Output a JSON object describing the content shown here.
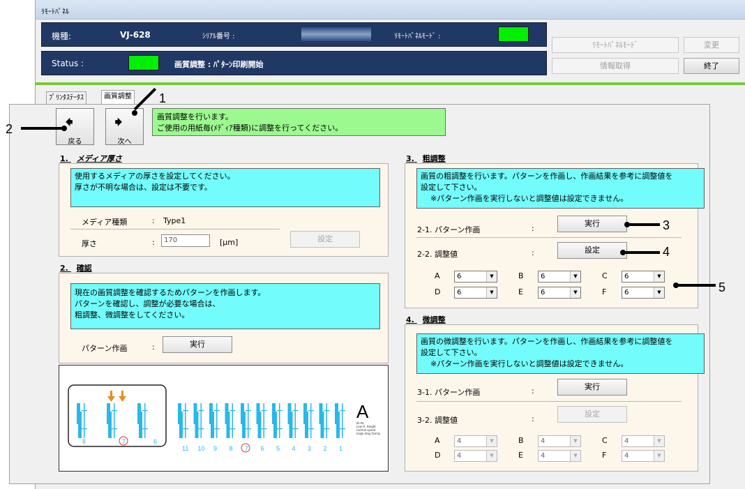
{
  "window": {
    "title": "ﾘﾓｰﾄﾊﾟﾈﾙ"
  },
  "header": {
    "model_label": "機種:",
    "model_value": "VJ-628",
    "serial_label": "ｼﾘｱﾙ番号 :",
    "remote_mode_label": "ﾘﾓｰﾄﾊﾟﾈﾙﾓｰﾄﾞ :",
    "status_label": "Status :",
    "status_text": "画質調整 : ﾊﾟﾀｰﾝ印刷開始",
    "lamp_color": "#00f000",
    "buttons": {
      "remote_mode": "ﾘﾓｰﾄﾊﾟﾈﾙﾓｰﾄﾞ",
      "change": "変更",
      "get_info": "情報取得",
      "exit": "終了"
    }
  },
  "tabs": [
    {
      "label": "ﾌﾟﾘﾝﾀｽﾃｰﾀｽ",
      "active": false
    },
    {
      "label": "画質調整",
      "active": true
    }
  ],
  "nav": {
    "back_label": "戻る",
    "next_label": "次へ",
    "back_icon": "arrow-left-icon",
    "next_icon": "arrow-right-icon",
    "message_line1": "画質調整を行います。",
    "message_line2": "ご使用の用紙毎(ﾒﾃﾞｨｱ種類)に調整を行ってください。"
  },
  "section1": {
    "number": "1.",
    "title": "メディア厚さ",
    "info_line1": "使用するメディアの厚さを設定してください。",
    "info_line2": "厚さが不明な場合は、設定は不要です。",
    "media_type_label": "メディア種類",
    "colon": ":",
    "media_type_value": "Type1",
    "thickness_label": "厚さ",
    "thickness_value": "170",
    "unit": "[μm]",
    "set_button": "設定"
  },
  "section2": {
    "number": "2.",
    "title": "確認",
    "info_line1": "現在の画質調整を確認するためパターンを作画します。",
    "info_line2": "パターンを確認し、調整が必要な場合は、",
    "info_line3": "粗調整、微調整をしてください。",
    "pattern_label": "パターン作画",
    "colon": ":",
    "run_button": "実行"
  },
  "pattern_image": {
    "left_nums": [
      "8",
      "7",
      "6"
    ],
    "right_nums": [
      "11",
      "10",
      "9",
      "8",
      "7",
      "6",
      "5",
      "4",
      "3",
      "2",
      "1"
    ],
    "big_letter": "A",
    "caption_lines": [
      "Bi-dir.",
      "Low H. Height",
      "normal speed",
      "large drop family"
    ],
    "bar_color": "#2ab8ea",
    "arrow_color": "#f08a1c",
    "circle_color": "#e23030"
  },
  "section3": {
    "number": "3.",
    "title": "粗調整",
    "info_line1": "画質の粗調整を行います。パターンを作画し、作画結果を参考に調整値を",
    "info_line2": "設定して下さい。",
    "info_line3": "※パターン作画を実行しないと調整値は設定できません。",
    "row1_label": "2-1. パターン作画",
    "row2_label": "2-2. 調整値",
    "colon": ":",
    "run_button": "実行",
    "set_button": "設定",
    "combos": [
      {
        "letter": "A",
        "value": "6"
      },
      {
        "letter": "B",
        "value": "6"
      },
      {
        "letter": "C",
        "value": "6"
      },
      {
        "letter": "D",
        "value": "6"
      },
      {
        "letter": "E",
        "value": "6"
      },
      {
        "letter": "F",
        "value": "6"
      }
    ]
  },
  "section4": {
    "number": "4.",
    "title": "微調整",
    "info_line1": "画質の微調整を行います。パターンを作画し、作画結果を参考に調整値を",
    "info_line2": "設定して下さい。",
    "info_line3": "※パターン作画を実行しないと調整値は設定できません。",
    "row1_label": "3-1. パターン作画",
    "row2_label": "3-2. 調整値",
    "colon": ":",
    "run_button": "実行",
    "set_button": "設定",
    "combos": [
      {
        "letter": "A",
        "value": "4"
      },
      {
        "letter": "B",
        "value": "4"
      },
      {
        "letter": "C",
        "value": "4"
      },
      {
        "letter": "D",
        "value": "4"
      },
      {
        "letter": "E",
        "value": "4"
      },
      {
        "letter": "F",
        "value": "4"
      }
    ]
  },
  "callouts": [
    "1",
    "2",
    "3",
    "4",
    "5"
  ]
}
